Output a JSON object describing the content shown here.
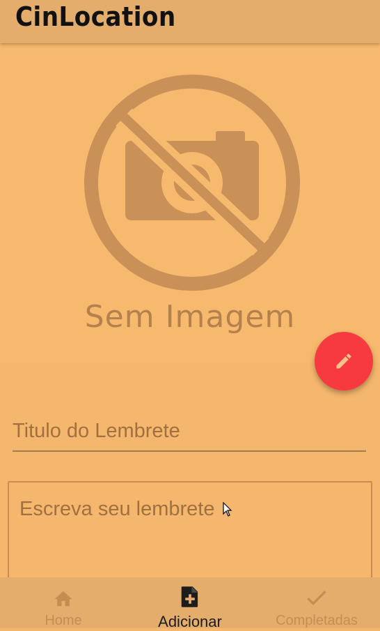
{
  "appbar": {
    "title": "CinLocation"
  },
  "image": {
    "placeholder_text": "Sem Imagem",
    "icon": "no-photo-icon"
  },
  "fab": {
    "icon": "edit-icon",
    "color": "#f73a3f"
  },
  "form": {
    "title_placeholder": "Titulo do Lembrete",
    "body_placeholder": "Escreva seu lembrete"
  },
  "bottom_nav": {
    "items": [
      {
        "label": "Home",
        "icon": "home-icon",
        "active": false
      },
      {
        "label": "Adicionar",
        "icon": "add-note-icon",
        "active": true
      },
      {
        "label": "Completadas",
        "icon": "check-icon",
        "active": false
      }
    ]
  },
  "colors": {
    "background": "#f5b76d",
    "appbar": "#e5ad6b",
    "accent": "#f73a3f"
  }
}
